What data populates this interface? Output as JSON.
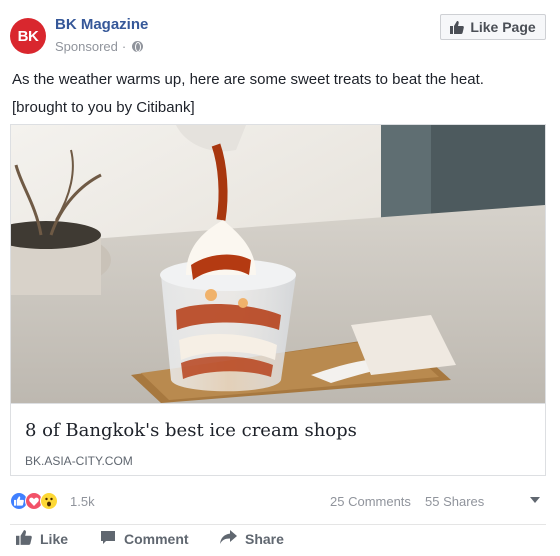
{
  "page": {
    "name": "BK Magazine",
    "avatar_text": "BK",
    "sponsored": "Sponsored",
    "separator": "·",
    "brand_color": "#d9272e"
  },
  "like_page_button": {
    "label": "Like Page",
    "icon": "thumbs-up-icon"
  },
  "post_text": {
    "line1": "As the weather warms up, here are some sweet treats to beat the heat.",
    "line2": "[brought to you by Citibank]"
  },
  "attachment": {
    "title": "8 of Bangkok's best ice cream shops",
    "domain": "BK.ASIA-CITY.COM"
  },
  "reactions": {
    "icons": [
      "like-reaction-icon",
      "love-reaction-icon",
      "wow-reaction-icon"
    ],
    "count": "1.5k",
    "comments": "25 Comments",
    "shares": "55 Shares"
  },
  "actions": {
    "like": "Like",
    "comment": "Comment",
    "share": "Share"
  }
}
